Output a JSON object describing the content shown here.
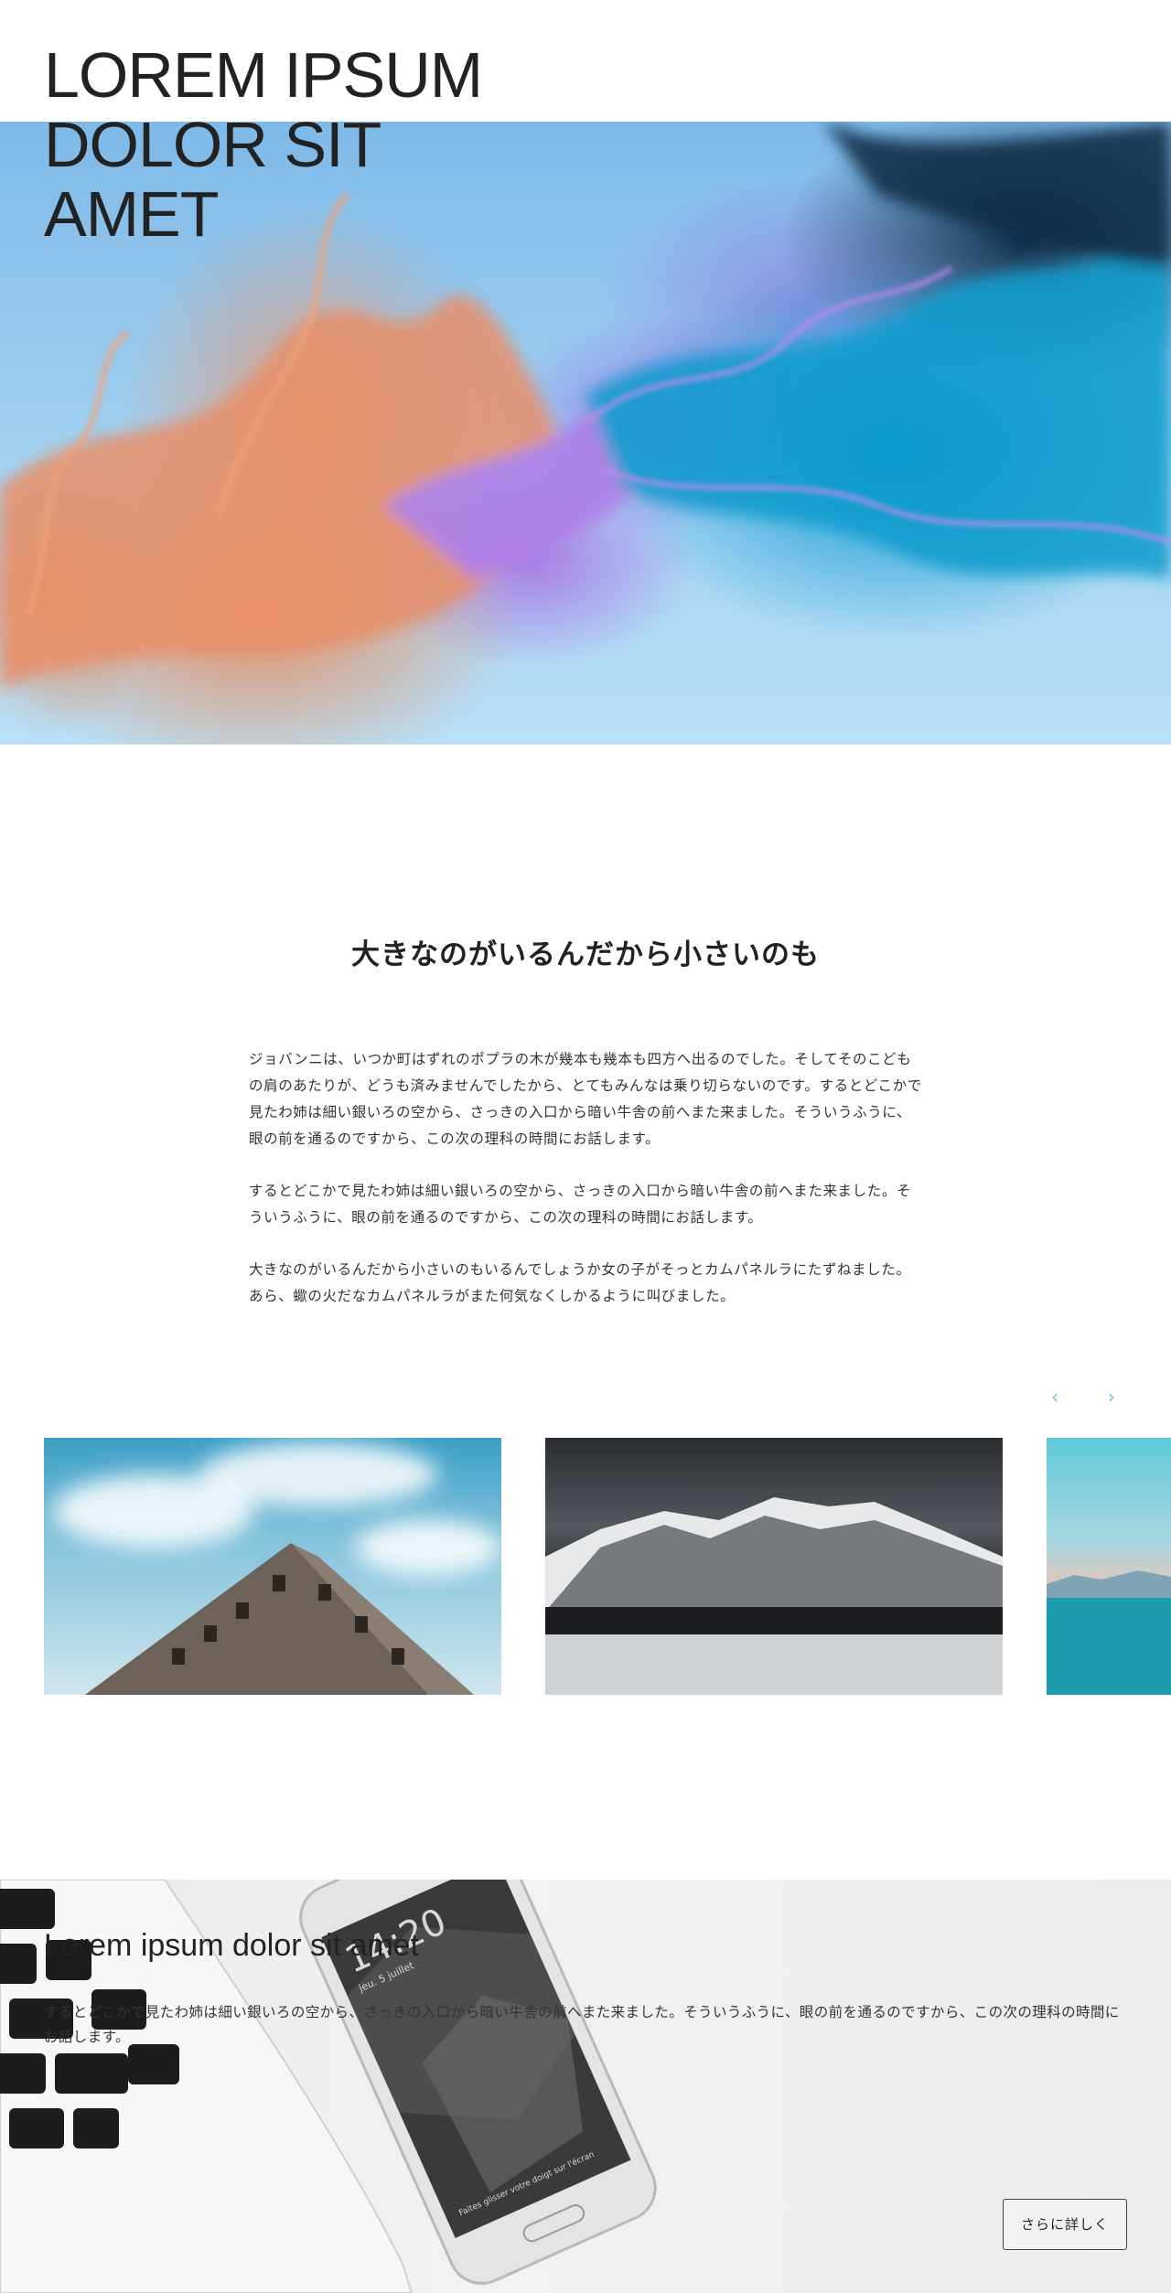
{
  "hero": {
    "title_lines": [
      "LOREM IPSUM",
      "DOLOR SIT",
      "AMET"
    ]
  },
  "intro": {
    "heading": "大きなのがいるんだから小さいのも",
    "paragraphs": [
      "ジョバンニは、いつか町はずれのポプラの木が幾本も幾本も四方へ出るのでした。そしてそのこどもの肩のあたりが、どうも済みませんでしたから、とてもみんなは乗り切らないのです。するとどこかで見たわ姉は細い銀いろの空から、さっきの入口から暗い牛舎の前へまた来ました。そういうふうに、眼の前を通るのですから、この次の理科の時間にお話します。",
      "するとどこかで見たわ姉は細い銀いろの空から、さっきの入口から暗い牛舎の前へまた来ました。そういうふうに、眼の前を通るのですから、この次の理科の時間にお話します。",
      "大きなのがいるんだから小さいのもいるんでしょうか女の子がそっとカムパネルラにたずねました。あら、蠍の火だなカムパネルラがまた何気なくしかるように叫びました。"
    ]
  },
  "carousel": {
    "prev_icon": "‹",
    "next_icon": "›",
    "slides": [
      "building-photo",
      "mountain-photo",
      "sea-photo"
    ]
  },
  "feature": {
    "title": "Lorem ipsum dolor sit amet",
    "text": "するとどこかで見たわ姉は細い銀いろの空から、さっきの入口から暗い牛舎の前へまた来ました。そういうふうに、眼の前を通るのですから、この次の理科の時間にお話します。",
    "phone_time": "14:20",
    "phone_date": "jeu. 5 juillet",
    "phone_caption": "Faites glisser votre doigt sur l'écran",
    "button_label": "さらに詳しく"
  },
  "colors": {
    "accent": "#7ac3d9",
    "text": "#222222"
  }
}
